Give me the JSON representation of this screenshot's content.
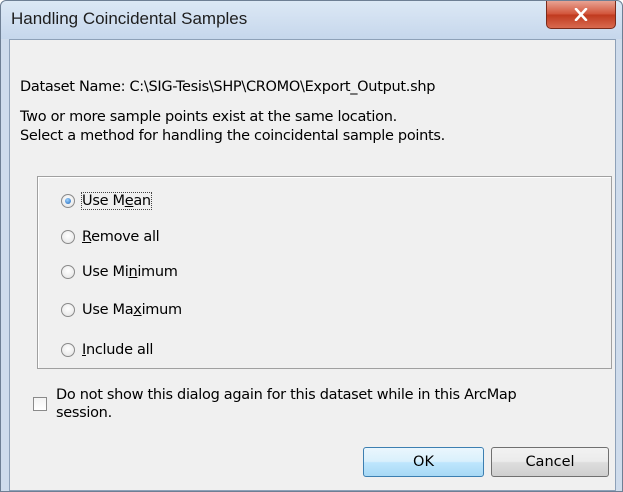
{
  "window": {
    "title": "Handling Coincidental Samples",
    "close_icon": "close-icon"
  },
  "dataset": {
    "line": "Dataset Name: C:\\SIG-Tesis\\SHP\\CROMO\\Export_Output.shp"
  },
  "message": {
    "line1": "Two or more sample points exist at the same location.",
    "line2": "Select a method for handling the coincidental sample points."
  },
  "options": [
    {
      "pre": "Use M",
      "u": "e",
      "post": "an",
      "checked": true
    },
    {
      "pre": "",
      "u": "R",
      "post": "emove all",
      "checked": false
    },
    {
      "pre": "Use Mi",
      "u": "n",
      "post": "imum",
      "checked": false
    },
    {
      "pre": "Use Ma",
      "u": "x",
      "post": "imum",
      "checked": false
    },
    {
      "pre": "",
      "u": "I",
      "post": "nclude all",
      "checked": false
    }
  ],
  "dont_show": {
    "line1": "Do not show this dialog again for this dataset while in this ArcMap",
    "line2": "session.",
    "checked": false
  },
  "buttons": {
    "ok": "OK",
    "cancel": "Cancel"
  }
}
